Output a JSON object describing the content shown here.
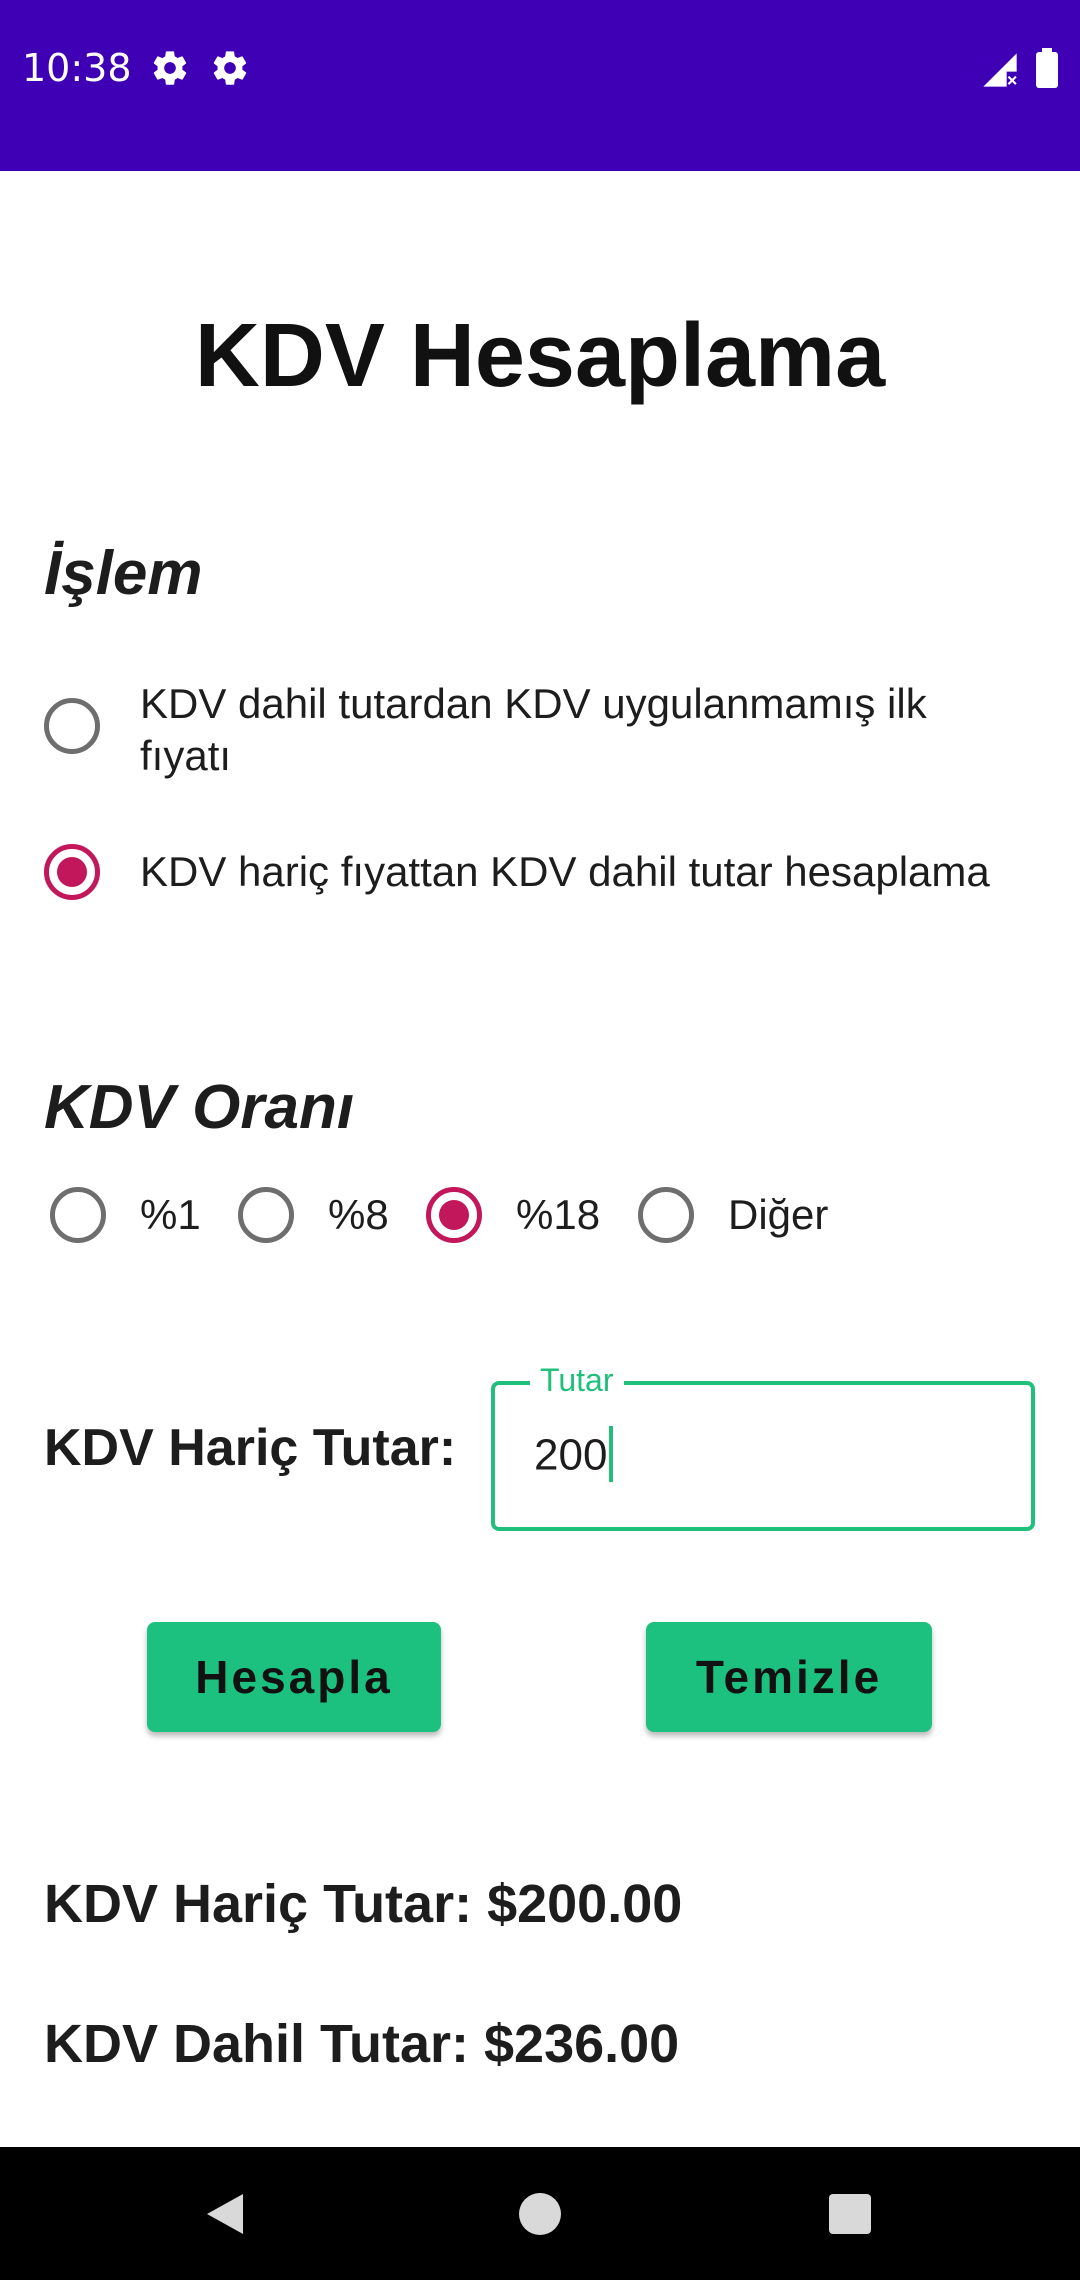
{
  "status_bar": {
    "time": "10:38",
    "background": "#3f00b5",
    "icons": [
      "gear-icon",
      "gear-icon",
      "signal-icon",
      "battery-icon"
    ]
  },
  "title": "KDV Hesaplama",
  "operation": {
    "heading": "İşlem",
    "options": [
      {
        "label": "KDV dahil tutardan KDV uygulanmamış ilk fıyatı",
        "selected": false
      },
      {
        "label": "KDV hariç fıyattan KDV dahil tutar hesaplama",
        "selected": true
      }
    ]
  },
  "rate": {
    "heading": "KDV Oranı",
    "options": [
      {
        "label": "%1",
        "selected": false
      },
      {
        "label": "%8",
        "selected": false
      },
      {
        "label": "%18",
        "selected": true
      },
      {
        "label": "Diğer",
        "selected": false
      }
    ]
  },
  "amount": {
    "label": "KDV Hariç Tutar:",
    "field_legend": "Tutar",
    "field_value": "200"
  },
  "buttons": {
    "calculate": "Hesapla",
    "clear": "Temizle"
  },
  "results": {
    "excluded": "KDV Hariç Tutar: $200.00",
    "included": "KDV Dahil Tutar: $236.00"
  },
  "colors": {
    "accent": "#1dc17f",
    "radio_checked": "#c2185b",
    "status_bar": "#3f00b5"
  }
}
